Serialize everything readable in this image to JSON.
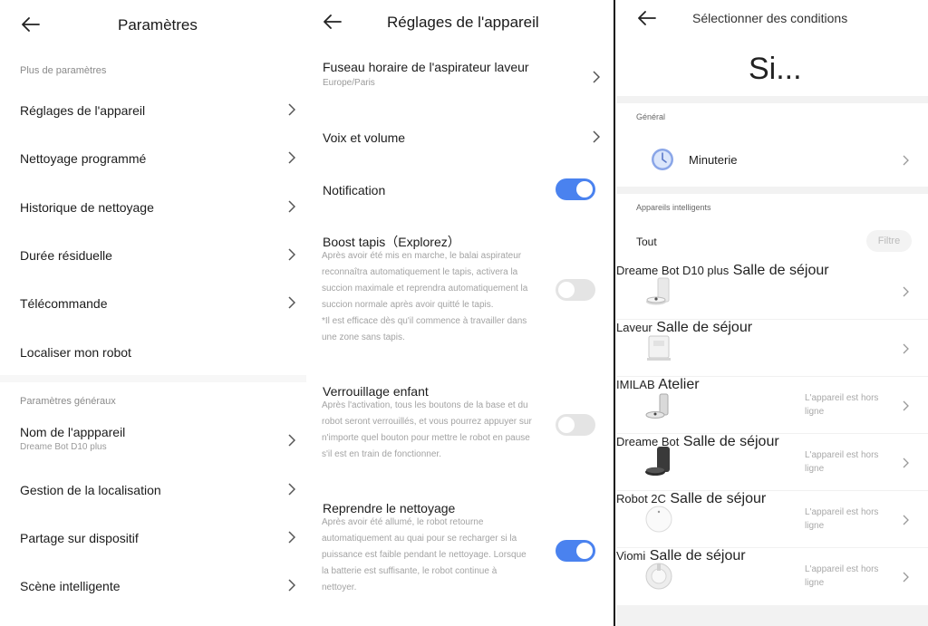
{
  "panel1": {
    "title": "Paramètres",
    "section1": "Plus de paramètres",
    "items1": [
      {
        "label": "Réglages de l'appareil"
      },
      {
        "label": "Nettoyage programmé"
      },
      {
        "label": "Historique de nettoyage"
      },
      {
        "label": "Durée résiduelle"
      },
      {
        "label": "Télécommande"
      },
      {
        "label": "Localiser mon robot"
      }
    ],
    "section2": "Paramètres généraux",
    "device_name": {
      "label": "Nom de l'apppareil",
      "value": "Dreame Bot D10 plus"
    },
    "items2": [
      {
        "label": "Gestion de la localisation"
      },
      {
        "label": "Partage sur dispositif"
      },
      {
        "label": "Scène intelligente"
      }
    ]
  },
  "panel2": {
    "title": "Réglages de l'appareil",
    "timezone": {
      "label": "Fuseau horaire de l'aspirateur laveur",
      "value": "Europe/Paris"
    },
    "voice": {
      "label": "Voix et volume"
    },
    "notification": {
      "label": "Notification",
      "on": true
    },
    "boost": {
      "label": "Boost tapis（Explorez）",
      "lines": [
        "Après avoir été mis en marche, le balai aspirateur",
        "reconnaîtra automatiquement le tapis, activera la",
        "succion maximale et reprendra automatiquement la",
        "succion normale après avoir quitté le tapis.",
        "*Il est efficace dès qu'il commence à travailler dans",
        "une zone sans tapis."
      ],
      "on": false
    },
    "child_lock": {
      "label": "Verrouillage enfant",
      "lines": [
        "Après l'activation, tous les boutons de la base et du",
        "robot seront verrouillés, et vous pourrez appuyer sur",
        "n'importe quel bouton pour mettre le robot en pause",
        "s'il est en train de fonctionner."
      ],
      "on": false
    },
    "resume": {
      "label": "Reprendre le nettoyage",
      "lines": [
        "Après avoir été allumé, le robot retourne",
        "automatiquement au quai pour se recharger si la",
        "puissance est faible pendant le nettoyage. Lorsque",
        "la batterie est suffisante, le robot continue à",
        "nettoyer."
      ],
      "on": true
    }
  },
  "panel3": {
    "title": "Sélectionner des conditions",
    "big_title": "Si...",
    "section_general": "Général",
    "timer_label": "Minuterie",
    "section_devices": "Appareils intelligents",
    "filter_all": "Tout",
    "filter_button": "Filtre",
    "devices": [
      {
        "name": "Dreame Bot D10 plus",
        "room": "Salle de séjour",
        "status1": "",
        "status2": ""
      },
      {
        "name": "Laveur",
        "room": "Salle de séjour",
        "status1": "",
        "status2": ""
      },
      {
        "name": "IMILAB",
        "room": "Atelier",
        "status1": "L'appareil est hors",
        "status2": "ligne"
      },
      {
        "name": "Dreame Bot",
        "room": "Salle de séjour",
        "status1": "L'appareil est hors",
        "status2": "ligne"
      },
      {
        "name": "Robot 2C",
        "room": "Salle de séjour",
        "status1": "L'appareil est hors",
        "status2": "ligne"
      },
      {
        "name": "Viomi",
        "room": "Salle de séjour",
        "status1": "L'appareil est hors",
        "status2": "ligne"
      }
    ]
  }
}
